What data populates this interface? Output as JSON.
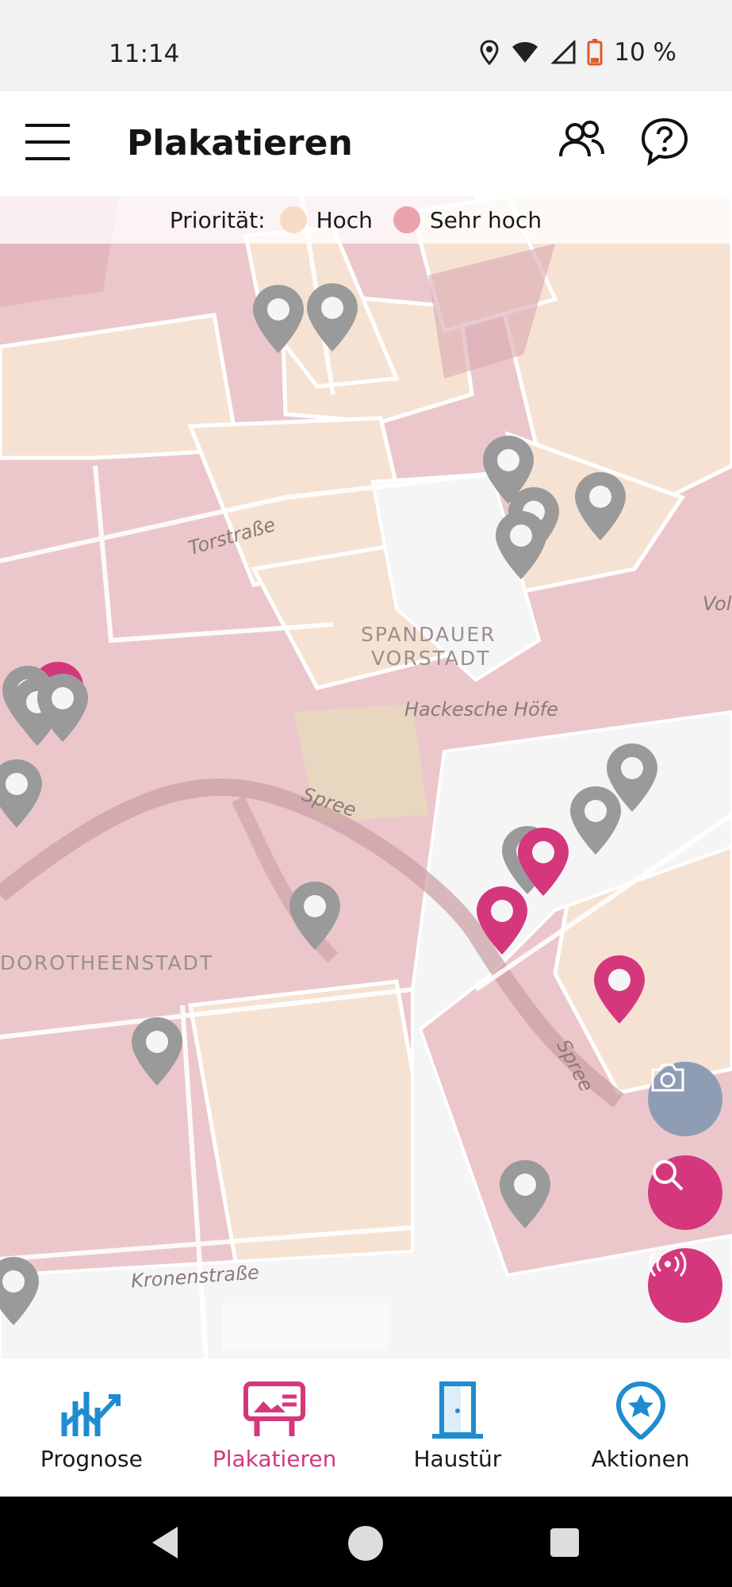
{
  "status": {
    "time": "11:14",
    "battery": "10 %"
  },
  "app_bar": {
    "title": "Plakatieren"
  },
  "legend": {
    "label": "Priorität:",
    "items": [
      {
        "label": "Hoch",
        "color": "#f6dcc4"
      },
      {
        "label": "Sehr hoch",
        "color": "#eaa3ad"
      }
    ]
  },
  "map": {
    "labels": {
      "torstrasse": "Torstraße",
      "spandauer": "SPANDAUER",
      "vorstadt": "VORSTADT",
      "hackesche": "Hackesche Höfe",
      "spree1": "Spree",
      "spree2": "Spree",
      "dorotheenstadt": "DOROTHEENSTADT",
      "kronenstrasse": "Kronenstraße",
      "vol": "Vol"
    }
  },
  "nav": {
    "items": [
      {
        "label": "Prognose",
        "icon": "chart-icon"
      },
      {
        "label": "Plakatieren",
        "icon": "billboard-icon"
      },
      {
        "label": "Haustür",
        "icon": "door-icon"
      },
      {
        "label": "Aktionen",
        "icon": "star-pin-icon"
      }
    ],
    "active": "Plakatieren"
  },
  "colors": {
    "accent": "#d4377c",
    "nav_blue": "#1f8ccf",
    "pin_gray": "#9a9a9a"
  }
}
